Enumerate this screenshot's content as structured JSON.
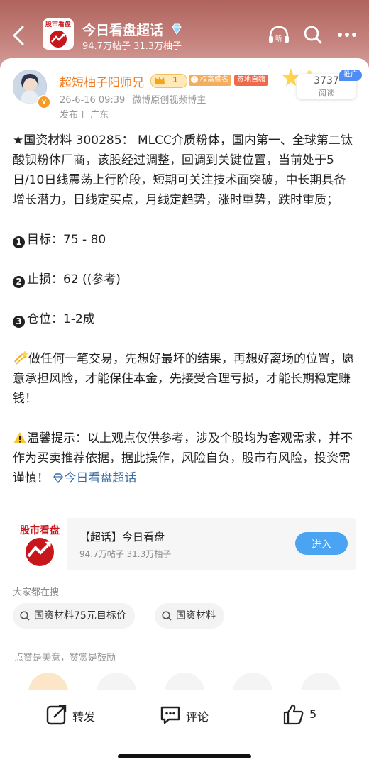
{
  "header": {
    "topic_title": "今日看盘超话",
    "topic_stats": "94.7万帖子 31.3万柚子",
    "logo_text": "股市看盘"
  },
  "author": {
    "name": "超短柚子阳师兄",
    "level": "1",
    "tag1": "权富盛名",
    "tag2": "签地自嗨",
    "time": "26-6-16 09:39",
    "role": "微博原创视频博主",
    "location": "发布于 广东",
    "verified_mark": "v"
  },
  "promo": {
    "badge": "推广",
    "views": "3737",
    "views_label": "阅读"
  },
  "post": {
    "intro": "★国资材料 300285： MLCC介质粉体，国内第一、全球第二钛酸钡粉体厂商，该股经过调整，回调到关键位置，当前处于5日/10日线震荡上行阶段，短期可关注技术面突破，中长期具备增长潜力，日线定买点，月线定趋势，涨时重势，跌时重质；",
    "n1": "1",
    "item1": "目标：75 - 80",
    "n2": "2",
    "item2": "止损：62 ((参考)",
    "n3": "3",
    "item3": "仓位：1-2成",
    "advice": "做任何一笔交易，先想好最坏的结果，再想好离场的位置，愿意承担风险，才能保住本金，先接受合理亏损，才能长期稳定赚钱！",
    "warning": "温馨提示：以上观点仅供参考，涉及个股均为客观需求，并不作为买卖推荐依据，据此操作，风险自负，股市有风险，投资需谨慎！",
    "topic_link": "今日看盘超话"
  },
  "supertopic_card": {
    "title": "【超话】今日看盘",
    "stats": "94.7万帖子 31.3万柚子",
    "enter_label": "进入",
    "logo_text": "股市看盘"
  },
  "search": {
    "title": "大家都在搜",
    "chips": [
      "国资材料75元目标价",
      "国资材料"
    ]
  },
  "like_hint": "点赞是美意，赞赏是鼓励",
  "bottom": {
    "repost": "转发",
    "comment": "评论",
    "like_count": "5"
  },
  "colors": {
    "accent_orange": "#f07b20",
    "link_blue": "#3a6ea5",
    "button_blue": "#4aa4f2",
    "header_red": "#b0635d"
  },
  "icons": [
    "back-arrow-icon",
    "listen-icon",
    "search-icon",
    "more-icon",
    "diamond-icon",
    "crown-icon",
    "repost-icon",
    "comment-icon",
    "like-icon"
  ]
}
